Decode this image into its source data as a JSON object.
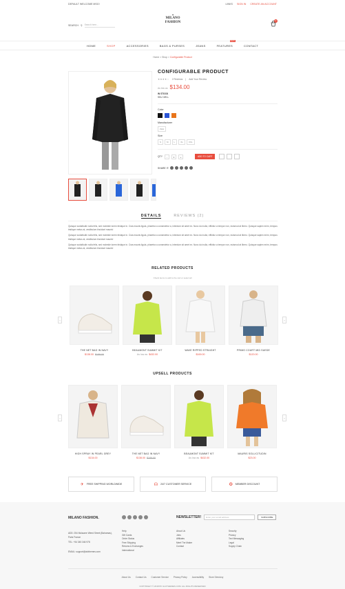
{
  "topbar": {
    "welcome": "DEFAULT WELCOME MSG!",
    "links": "LINKS",
    "signin": "SIGN IN",
    "create": "CREATE AN ACCOUNT"
  },
  "logo": {
    "line1": "MILANO",
    "line2": "FASHION"
  },
  "search": {
    "label": "SEARCH",
    "placeholder": "Search here..."
  },
  "cart": {
    "count": "0"
  },
  "nav": {
    "items": [
      "HOME",
      "SHOP",
      "ACCESSORIES",
      "BAGS & PURSES",
      "JEANS",
      "FEATURES",
      "CONTACT"
    ],
    "new_badge": "NEW"
  },
  "breadcrumb": {
    "home": "Home",
    "shop": "Shop",
    "current": "Configurable Product"
  },
  "product": {
    "title": "CONFIGURABLE PRODUCT",
    "stars": "★★★★☆",
    "reviews": "2 Reviews",
    "add_review": "Add Your Review",
    "old_price": "As low as",
    "price": "$134.00",
    "stock": "IN STOCK",
    "sku": "SKU: MH-L",
    "color_label": "Color",
    "manu_label": "Manufacturer",
    "manu_value": "Zara",
    "size_label": "Size",
    "sizes": [
      "S",
      "M",
      "L",
      "XL",
      "XXL"
    ],
    "qty_label": "QTY",
    "qty": "1",
    "add_to_cart": "ADD TO CART",
    "share": "SHARE IT:"
  },
  "tabs": {
    "details": "DETAILS",
    "reviews": "REVIEWS (2)"
  },
  "desc": [
    "Quisque sodalitudin nulla felis, sed molestie lorem tristique in. Cras mauris ligula, pharetra a consectetur a, interdum sit amet ex. Nunc dui nulla, efficitur a tempor non, euismod at libero. Quisque sapien enim, tempus tristique metus at, vestibulum tincidunt mauris!",
    "Quisque sodalitudin nulla felis, sed molestie lorem tristique in. Cras mauris ligula, pharetra a consectetur a, interdum sit amet ex. Nunc dui nulla, efficitur a tempor non, euismod at libero. Quisque sapien enim, tempus tristique metus at, vestibulum tincidunt mauris!",
    "Quisque sodalitudin nulla felis, sed molestie lorem tristique in. Cras mauris ligula, pharetra a consectetur a, interdum sit amet ex. Nunc dui nulla, efficitur a tempor non, euismod at libero. Quisque sapien enim, tempus tristique metus at, vestibulum tincidunt mauris!"
  ],
  "related": {
    "title": "RELATED PRODUCTS",
    "sub": "Check items to add to the cart or select all",
    "items": [
      {
        "name": "THE NET BAG IN NAVY",
        "price": "$138.00",
        "old": "$189.00"
      },
      {
        "name": "BEAUMONT SUMMIT KIT",
        "price": "$432.00",
        "old": "As low as"
      },
      {
        "name": "WAVE RIPPED STRAIGHT",
        "price": "$169.00",
        "old": ""
      },
      {
        "name": "PRIMO COURT MID SUEDE",
        "price": "$120.00",
        "old": ""
      }
    ]
  },
  "upsell": {
    "title": "UPSELL PRODUCTS",
    "items": [
      {
        "name": "HIGH SPRAY IN PEARL GREY",
        "price": "$134.00",
        "old": ""
      },
      {
        "name": "THE NET BAG IN NAVY",
        "price": "$138.00",
        "old": "$189.00"
      },
      {
        "name": "BEAUMONT SUMMIT KIT",
        "price": "$432.00",
        "old": "As low as"
      },
      {
        "name": "MAURIS SOLLICITUDIN",
        "price": "$23.00",
        "old": ""
      }
    ]
  },
  "features": [
    "FREE SHIPPING WORLDWIDE",
    "24/7 CUSTOMER SERVICE",
    "MEMBER DISCOUNT"
  ],
  "footer": {
    "brand": "MILANO FASHION.",
    "newsletter": "NEWSLETTER!",
    "email_placeholder": "Enter your email address",
    "subscribe": "SUBSCRIBE",
    "address": "ADD: 254 Molaume Weed Street (Bahamas), Paris France",
    "tel": "TEL: +54 345 346 978",
    "email": "EMAIL: support@alothemes.com",
    "col1": [
      "Help",
      "Gift Cards",
      "Order Status",
      "Free Shipping",
      "Returns & Exchanges",
      "International"
    ],
    "col2": [
      "About Us",
      "Jobs",
      "Affiliates",
      "Meet The Maker",
      "Contact"
    ],
    "col3": [
      "Security",
      "Privacy",
      "Text Messaging",
      "Legal",
      "Supply Chain"
    ],
    "links": [
      "About Us",
      "Contact Us",
      "Customer Service",
      "Privacy Policy",
      "Accessibility",
      "Store Directory"
    ],
    "copyright": "COPYRIGHT © 2018 BY ALOTHEMES.COM. ALL RIGHTS RESERVED"
  },
  "colors": {
    "accent": "#e84c3d",
    "swatches": [
      "#111111",
      "#2b55d6",
      "#e8741a"
    ]
  }
}
